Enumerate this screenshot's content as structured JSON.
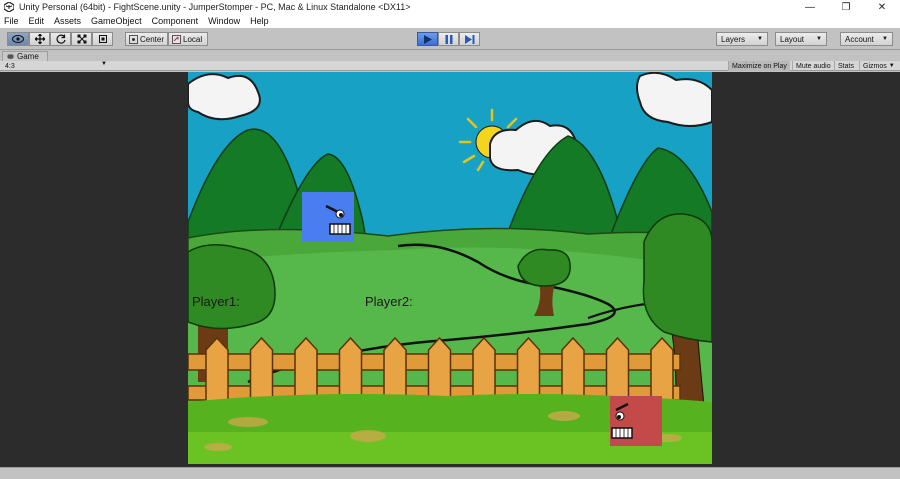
{
  "window": {
    "title": "Unity Personal (64bit) - FightScene.unity - JumperStomper - PC, Mac & Linux Standalone <DX11>",
    "controls": [
      "—",
      "❐",
      "✕"
    ]
  },
  "menu": {
    "items": [
      "File",
      "Edit",
      "Assets",
      "GameObject",
      "Component",
      "Window",
      "Help"
    ]
  },
  "toolbar": {
    "pivot_label": "Center",
    "space_label": "Local",
    "layers_label": "Layers",
    "layout_label": "Layout",
    "account_label": "Account"
  },
  "game_view": {
    "tab_label": "Game",
    "aspect_label": "4:3",
    "maximize_label": "Maximize on Play",
    "mute_label": "Mute audio",
    "stats_label": "Stats",
    "gizmos_label": "Gizmos"
  },
  "scene": {
    "player1_label": "Player1:",
    "player2_label": "Player2:"
  },
  "colors": {
    "sky": "#17a1c4",
    "play_active": "#3a6fd8",
    "player_blue": "#4a7ef0",
    "player_red": "#c44a4a"
  }
}
